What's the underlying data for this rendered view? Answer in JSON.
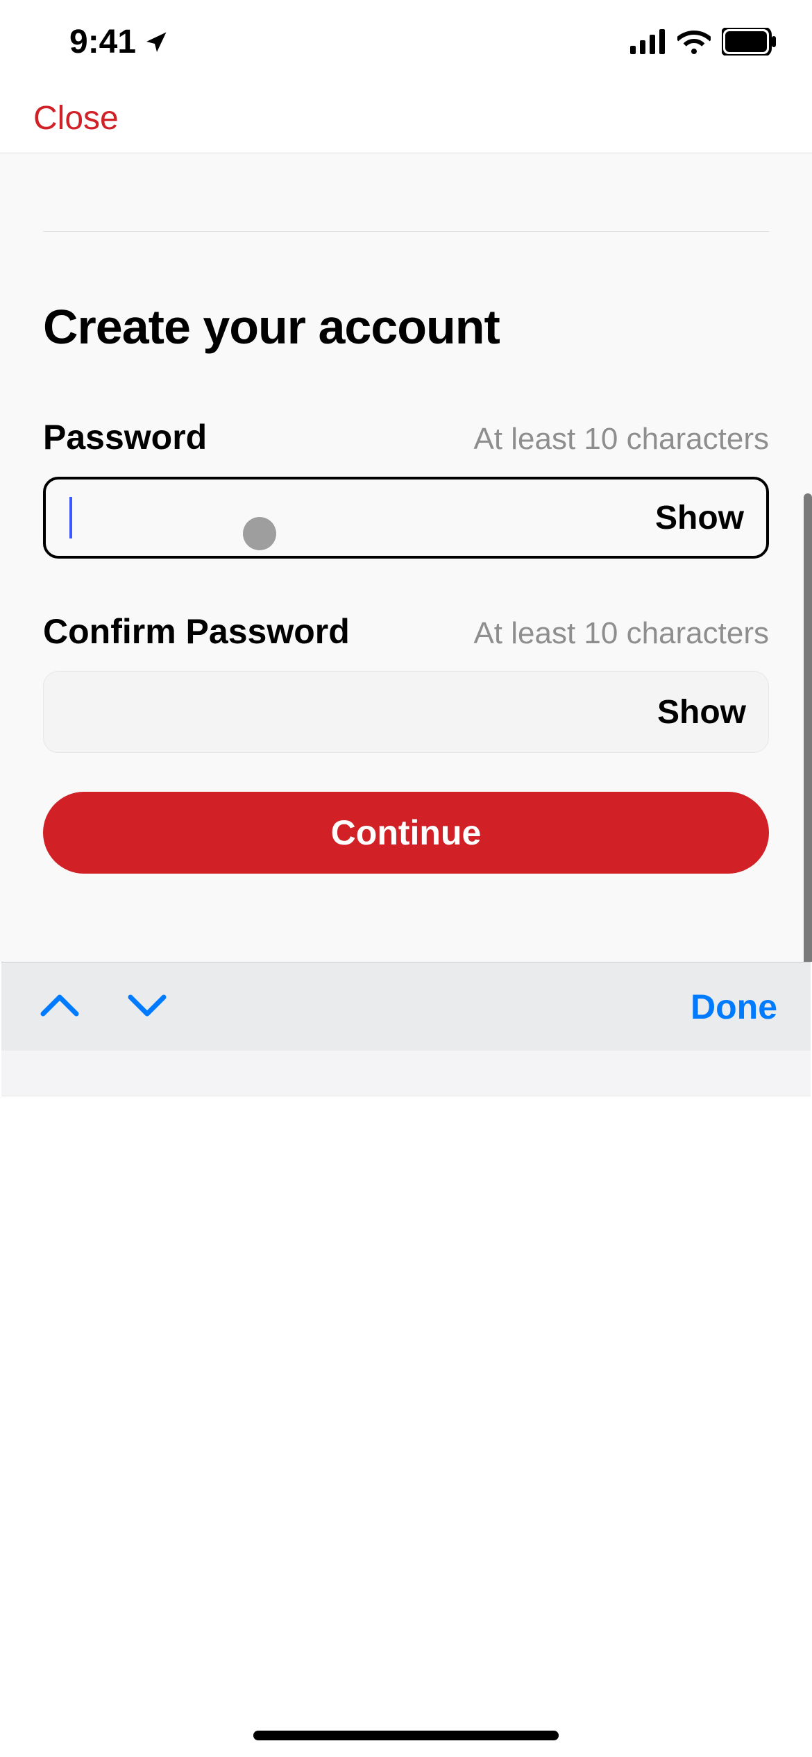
{
  "status": {
    "time": "9:41"
  },
  "nav": {
    "close_label": "Close"
  },
  "form": {
    "heading": "Create your account",
    "password": {
      "label": "Password",
      "hint": "At least 10 characters",
      "value": "",
      "show_label": "Show"
    },
    "confirm": {
      "label": "Confirm Password",
      "hint": "At least 10 characters",
      "value": "",
      "show_label": "Show"
    },
    "continue_label": "Continue"
  },
  "keyboard_toolbar": {
    "done_label": "Done"
  }
}
